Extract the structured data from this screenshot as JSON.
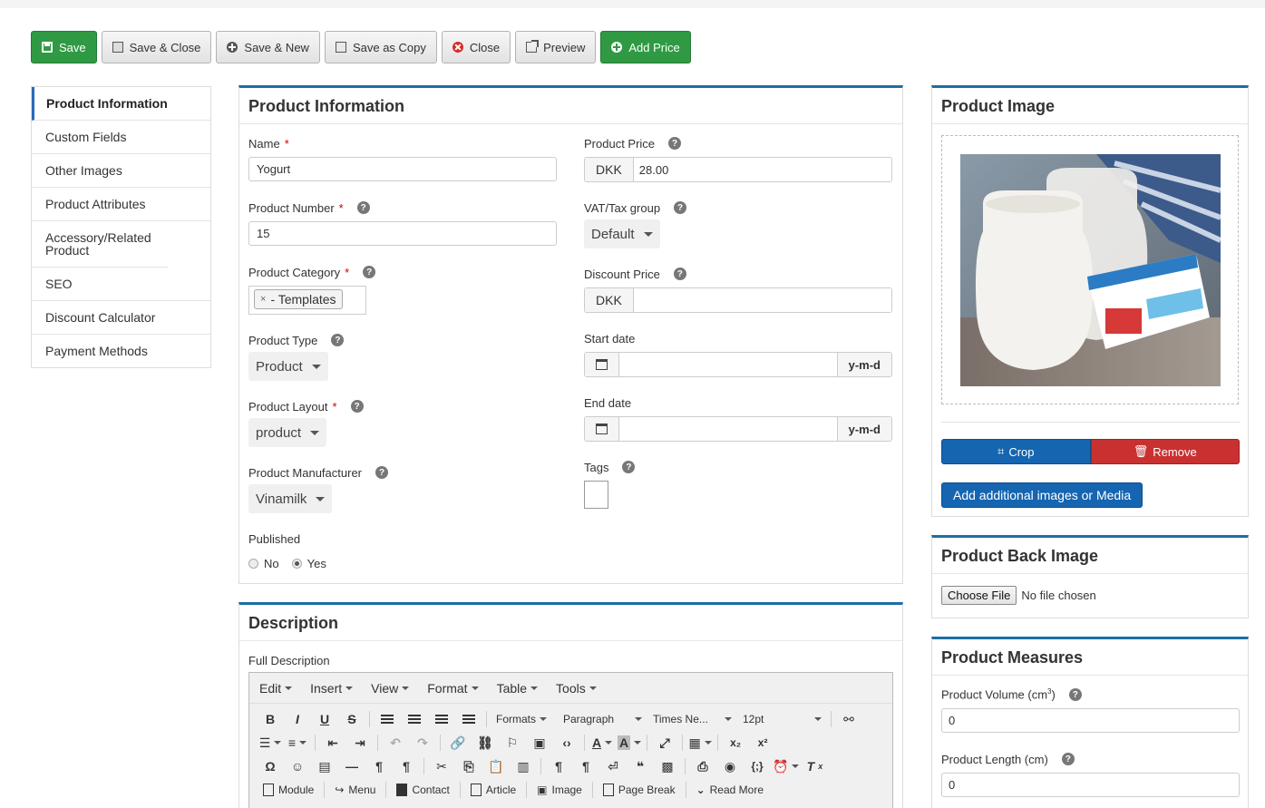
{
  "toolbar": {
    "save": "Save",
    "save_close": "Save & Close",
    "save_new": "Save & New",
    "save_copy": "Save as Copy",
    "close": "Close",
    "preview": "Preview",
    "add_price": "Add Price"
  },
  "sidenav": {
    "items": [
      "Product Information",
      "Custom Fields",
      "Other Images",
      "Product Attributes",
      "Accessory/Related Product",
      "SEO",
      "Discount Calculator",
      "Payment Methods"
    ]
  },
  "info": {
    "title": "Product Information",
    "name_label": "Name",
    "name_value": "Yogurt",
    "number_label": "Product Number",
    "number_value": "15",
    "category_label": "Product Category",
    "category_chip": "- Templates",
    "type_label": "Product Type",
    "type_value": "Product",
    "layout_label": "Product Layout",
    "layout_value": "product",
    "manufacturer_label": "Product Manufacturer",
    "manufacturer_value": "Vinamilk",
    "published_label": "Published",
    "published_no": "No",
    "published_yes": "Yes",
    "price_label": "Product Price",
    "currency": "DKK",
    "price_value": "28.00",
    "vat_label": "VAT/Tax group",
    "vat_value": "Default",
    "discount_label": "Discount Price",
    "discount_value": "",
    "start_label": "Start date",
    "end_label": "End date",
    "date_format": "y-m-d",
    "tags_label": "Tags"
  },
  "description": {
    "title": "Description",
    "full_label": "Full Description",
    "menus": [
      "Edit",
      "Insert",
      "View",
      "Format",
      "Table",
      "Tools"
    ],
    "formats": "Formats",
    "paragraph": "Paragraph",
    "font": "Times Ne...",
    "size": "12pt",
    "insert_buttons": [
      "Module",
      "Menu",
      "Contact",
      "Article",
      "Image",
      "Page Break",
      "Read More"
    ]
  },
  "product_image": {
    "title": "Product Image",
    "crop": "Crop",
    "remove": "Remove",
    "add_media": "Add additional images or Media",
    "colors": {
      "primary": "#1565b0",
      "danger": "#c93131"
    }
  },
  "back_image": {
    "title": "Product Back Image",
    "choose": "Choose File",
    "no_file": "No file chosen"
  },
  "measures": {
    "title": "Product Measures",
    "volume_label": "Product Volume (cm",
    "volume_sup": "3",
    "volume_close": ")",
    "volume_value": "0",
    "length_label": "Product Length (cm)",
    "length_value": "0"
  }
}
